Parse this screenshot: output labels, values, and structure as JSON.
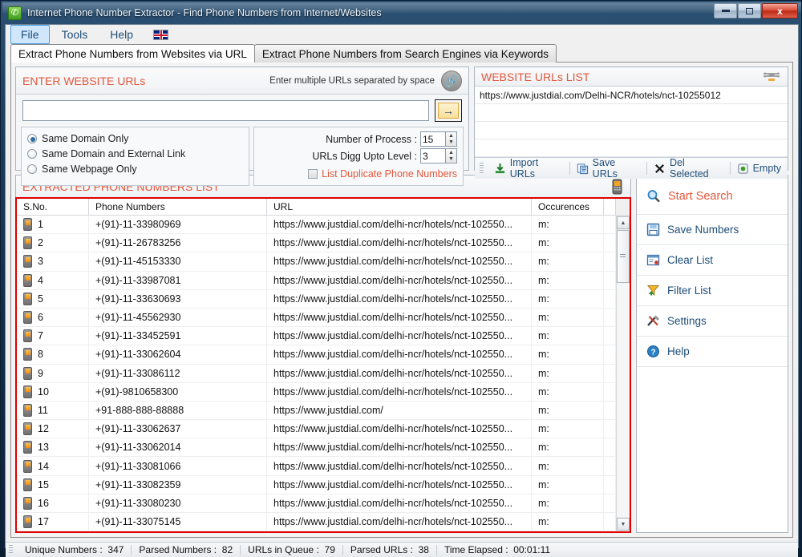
{
  "window": {
    "title": "Internet Phone Number Extractor - Find Phone Numbers from Internet/Websites",
    "app_icon": "phone-icon",
    "minimize": "–",
    "maximize": "□",
    "close": "x"
  },
  "menu": {
    "items": [
      {
        "label": "File",
        "active": true
      },
      {
        "label": "Tools",
        "active": false
      },
      {
        "label": "Help",
        "active": false
      }
    ],
    "flag": "uk-flag-icon"
  },
  "tabs": [
    {
      "label": "Extract Phone Numbers from Websites via URL",
      "selected": true
    },
    {
      "label": "Extract Phone Numbers from Search Engines via Keywords",
      "selected": false
    }
  ],
  "enter_urls": {
    "title": "ENTER WEBSITE URLs",
    "hint": "Enter multiple URLs separated by space",
    "link_icon": "link-icon",
    "input_value": "",
    "input_placeholder": "",
    "go_label": "→",
    "radios": [
      {
        "label": "Same Domain Only",
        "checked": true
      },
      {
        "label": "Same Domain and External Link",
        "checked": false
      },
      {
        "label": "Same Webpage Only",
        "checked": false
      }
    ],
    "spinners": [
      {
        "label": "Number of Process :",
        "value": "15"
      },
      {
        "label": "URLs Digg Upto Level :",
        "value": "3"
      }
    ],
    "duplicate_checkbox": {
      "label": "List Duplicate Phone Numbers",
      "checked": false
    }
  },
  "urls_list": {
    "title": "WEBSITE URLs LIST",
    "header_icon": "list-icon",
    "rows": [
      "https://www.justdial.com/Delhi-NCR/hotels/nct-10255012",
      "",
      "",
      "",
      ""
    ],
    "toolbar": [
      {
        "label": "Import URLs",
        "icon": "import-icon"
      },
      {
        "label": "Save URLs",
        "icon": "save-icon"
      },
      {
        "label": "Del Selected",
        "icon": "delete-x-icon"
      },
      {
        "label": "Empty",
        "icon": "empty-icon"
      }
    ]
  },
  "extracted": {
    "title": "EXTRACTED PHONE NUMBERS LIST",
    "header_icon": "phone-icon",
    "columns": [
      "S.No.",
      "Phone Numbers",
      "URL",
      "Occurences",
      ""
    ],
    "rows": [
      {
        "sno": "1",
        "phone": "+(91)-11-33980969",
        "url": "https://www.justdial.com/delhi-ncr/hotels/nct-102550...",
        "occ": "m:"
      },
      {
        "sno": "2",
        "phone": "+(91)-11-26783256",
        "url": "https://www.justdial.com/delhi-ncr/hotels/nct-102550...",
        "occ": "m:"
      },
      {
        "sno": "3",
        "phone": "+(91)-11-45153330",
        "url": "https://www.justdial.com/delhi-ncr/hotels/nct-102550...",
        "occ": "m:"
      },
      {
        "sno": "4",
        "phone": "+(91)-11-33987081",
        "url": "https://www.justdial.com/delhi-ncr/hotels/nct-102550...",
        "occ": "m:"
      },
      {
        "sno": "5",
        "phone": "+(91)-11-33630693",
        "url": "https://www.justdial.com/delhi-ncr/hotels/nct-102550...",
        "occ": "m:"
      },
      {
        "sno": "6",
        "phone": "+(91)-11-45562930",
        "url": "https://www.justdial.com/delhi-ncr/hotels/nct-102550...",
        "occ": "m:"
      },
      {
        "sno": "7",
        "phone": "+(91)-11-33452591",
        "url": "https://www.justdial.com/delhi-ncr/hotels/nct-102550...",
        "occ": "m:"
      },
      {
        "sno": "8",
        "phone": "+(91)-11-33062604",
        "url": "https://www.justdial.com/delhi-ncr/hotels/nct-102550...",
        "occ": "m:"
      },
      {
        "sno": "9",
        "phone": "+(91)-11-33086112",
        "url": "https://www.justdial.com/delhi-ncr/hotels/nct-102550...",
        "occ": "m:"
      },
      {
        "sno": "10",
        "phone": "+(91)-9810658300",
        "url": "https://www.justdial.com/delhi-ncr/hotels/nct-102550...",
        "occ": "m:"
      },
      {
        "sno": "11",
        "phone": "+91-888-888-88888",
        "url": "https://www.justdial.com/",
        "occ": "m:"
      },
      {
        "sno": "12",
        "phone": "+(91)-11-33062637",
        "url": "https://www.justdial.com/delhi-ncr/hotels/nct-102550...",
        "occ": "m:"
      },
      {
        "sno": "13",
        "phone": "+(91)-11-33062014",
        "url": "https://www.justdial.com/delhi-ncr/hotels/nct-102550...",
        "occ": "m:"
      },
      {
        "sno": "14",
        "phone": "+(91)-11-33081066",
        "url": "https://www.justdial.com/delhi-ncr/hotels/nct-102550...",
        "occ": "m:"
      },
      {
        "sno": "15",
        "phone": "+(91)-11-33082359",
        "url": "https://www.justdial.com/delhi-ncr/hotels/nct-102550...",
        "occ": "m:"
      },
      {
        "sno": "16",
        "phone": "+(91)-11-33080230",
        "url": "https://www.justdial.com/delhi-ncr/hotels/nct-102550...",
        "occ": "m:"
      },
      {
        "sno": "17",
        "phone": "+(91)-11-33075145",
        "url": "https://www.justdial.com/delhi-ncr/hotels/nct-102550...",
        "occ": "m:"
      }
    ]
  },
  "actions": [
    {
      "label": "Start Search",
      "icon": "search-icon"
    },
    {
      "label": "Save Numbers",
      "icon": "floppy-save-icon"
    },
    {
      "label": "Clear List",
      "icon": "clear-list-icon"
    },
    {
      "label": "Filter List",
      "icon": "funnel-filter-icon"
    },
    {
      "label": "Settings",
      "icon": "tools-settings-icon"
    },
    {
      "label": "Help",
      "icon": "question-help-icon"
    }
  ],
  "status": [
    {
      "label": "Unique Numbers :",
      "value": "347"
    },
    {
      "label": "Parsed Numbers :",
      "value": "82"
    },
    {
      "label": "URLs in Queue :",
      "value": "79"
    },
    {
      "label": "Parsed URLs :",
      "value": "38"
    },
    {
      "label": "Time Elapsed :",
      "value": "00:01:11"
    }
  ],
  "colors": {
    "accent_red": "#e2573c",
    "link_blue": "#1f4e79",
    "grid_border_red": "#e00000",
    "title_bar": "#1d3d5c"
  }
}
